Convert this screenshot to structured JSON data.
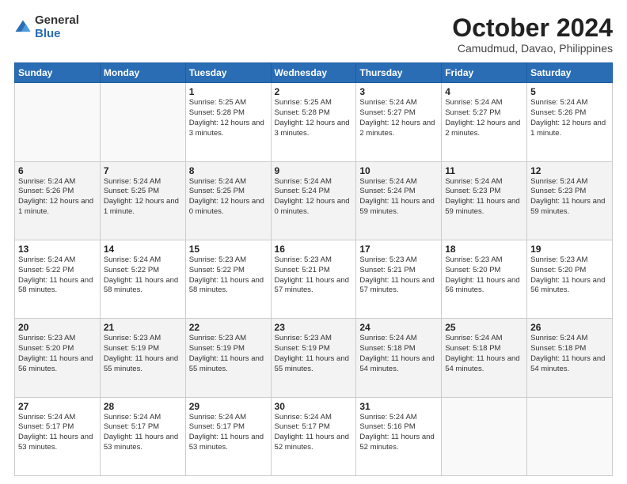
{
  "logo": {
    "general": "General",
    "blue": "Blue"
  },
  "header": {
    "month": "October 2024",
    "location": "Camudmud, Davao, Philippines"
  },
  "weekdays": [
    "Sunday",
    "Monday",
    "Tuesday",
    "Wednesday",
    "Thursday",
    "Friday",
    "Saturday"
  ],
  "weeks": [
    [
      {
        "day": "",
        "info": ""
      },
      {
        "day": "",
        "info": ""
      },
      {
        "day": "1",
        "info": "Sunrise: 5:25 AM\nSunset: 5:28 PM\nDaylight: 12 hours and 3 minutes."
      },
      {
        "day": "2",
        "info": "Sunrise: 5:25 AM\nSunset: 5:28 PM\nDaylight: 12 hours and 3 minutes."
      },
      {
        "day": "3",
        "info": "Sunrise: 5:24 AM\nSunset: 5:27 PM\nDaylight: 12 hours and 2 minutes."
      },
      {
        "day": "4",
        "info": "Sunrise: 5:24 AM\nSunset: 5:27 PM\nDaylight: 12 hours and 2 minutes."
      },
      {
        "day": "5",
        "info": "Sunrise: 5:24 AM\nSunset: 5:26 PM\nDaylight: 12 hours and 1 minute."
      }
    ],
    [
      {
        "day": "6",
        "info": "Sunrise: 5:24 AM\nSunset: 5:26 PM\nDaylight: 12 hours and 1 minute."
      },
      {
        "day": "7",
        "info": "Sunrise: 5:24 AM\nSunset: 5:25 PM\nDaylight: 12 hours and 1 minute."
      },
      {
        "day": "8",
        "info": "Sunrise: 5:24 AM\nSunset: 5:25 PM\nDaylight: 12 hours and 0 minutes."
      },
      {
        "day": "9",
        "info": "Sunrise: 5:24 AM\nSunset: 5:24 PM\nDaylight: 12 hours and 0 minutes."
      },
      {
        "day": "10",
        "info": "Sunrise: 5:24 AM\nSunset: 5:24 PM\nDaylight: 11 hours and 59 minutes."
      },
      {
        "day": "11",
        "info": "Sunrise: 5:24 AM\nSunset: 5:23 PM\nDaylight: 11 hours and 59 minutes."
      },
      {
        "day": "12",
        "info": "Sunrise: 5:24 AM\nSunset: 5:23 PM\nDaylight: 11 hours and 59 minutes."
      }
    ],
    [
      {
        "day": "13",
        "info": "Sunrise: 5:24 AM\nSunset: 5:22 PM\nDaylight: 11 hours and 58 minutes."
      },
      {
        "day": "14",
        "info": "Sunrise: 5:24 AM\nSunset: 5:22 PM\nDaylight: 11 hours and 58 minutes."
      },
      {
        "day": "15",
        "info": "Sunrise: 5:23 AM\nSunset: 5:22 PM\nDaylight: 11 hours and 58 minutes."
      },
      {
        "day": "16",
        "info": "Sunrise: 5:23 AM\nSunset: 5:21 PM\nDaylight: 11 hours and 57 minutes."
      },
      {
        "day": "17",
        "info": "Sunrise: 5:23 AM\nSunset: 5:21 PM\nDaylight: 11 hours and 57 minutes."
      },
      {
        "day": "18",
        "info": "Sunrise: 5:23 AM\nSunset: 5:20 PM\nDaylight: 11 hours and 56 minutes."
      },
      {
        "day": "19",
        "info": "Sunrise: 5:23 AM\nSunset: 5:20 PM\nDaylight: 11 hours and 56 minutes."
      }
    ],
    [
      {
        "day": "20",
        "info": "Sunrise: 5:23 AM\nSunset: 5:20 PM\nDaylight: 11 hours and 56 minutes."
      },
      {
        "day": "21",
        "info": "Sunrise: 5:23 AM\nSunset: 5:19 PM\nDaylight: 11 hours and 55 minutes."
      },
      {
        "day": "22",
        "info": "Sunrise: 5:23 AM\nSunset: 5:19 PM\nDaylight: 11 hours and 55 minutes."
      },
      {
        "day": "23",
        "info": "Sunrise: 5:23 AM\nSunset: 5:19 PM\nDaylight: 11 hours and 55 minutes."
      },
      {
        "day": "24",
        "info": "Sunrise: 5:24 AM\nSunset: 5:18 PM\nDaylight: 11 hours and 54 minutes."
      },
      {
        "day": "25",
        "info": "Sunrise: 5:24 AM\nSunset: 5:18 PM\nDaylight: 11 hours and 54 minutes."
      },
      {
        "day": "26",
        "info": "Sunrise: 5:24 AM\nSunset: 5:18 PM\nDaylight: 11 hours and 54 minutes."
      }
    ],
    [
      {
        "day": "27",
        "info": "Sunrise: 5:24 AM\nSunset: 5:17 PM\nDaylight: 11 hours and 53 minutes."
      },
      {
        "day": "28",
        "info": "Sunrise: 5:24 AM\nSunset: 5:17 PM\nDaylight: 11 hours and 53 minutes."
      },
      {
        "day": "29",
        "info": "Sunrise: 5:24 AM\nSunset: 5:17 PM\nDaylight: 11 hours and 53 minutes."
      },
      {
        "day": "30",
        "info": "Sunrise: 5:24 AM\nSunset: 5:17 PM\nDaylight: 11 hours and 52 minutes."
      },
      {
        "day": "31",
        "info": "Sunrise: 5:24 AM\nSunset: 5:16 PM\nDaylight: 11 hours and 52 minutes."
      },
      {
        "day": "",
        "info": ""
      },
      {
        "day": "",
        "info": ""
      }
    ]
  ]
}
